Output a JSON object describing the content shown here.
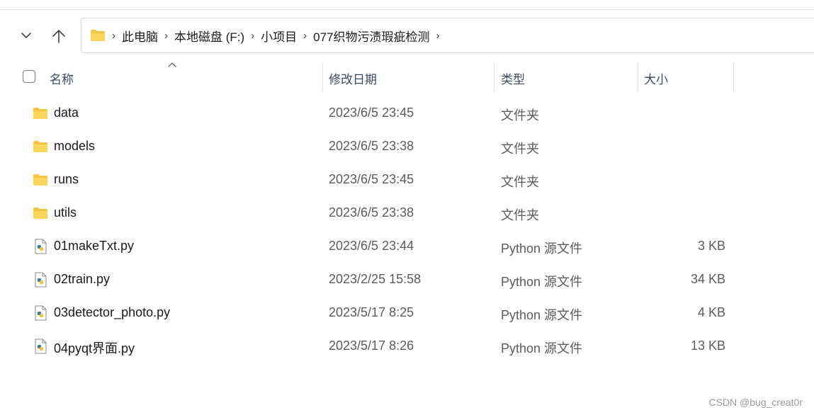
{
  "navigation": {
    "recent_icon": "chevron-down",
    "up_icon": "arrow-up"
  },
  "address": {
    "folder_icon": "folder",
    "crumbs": [
      "此电脑",
      "本地磁盘 (F:)",
      "小项目",
      "077织物污渍瑕疵检测"
    ],
    "separator": "›"
  },
  "columns": {
    "name": "名称",
    "date": "修改日期",
    "type": "类型",
    "size": "大小"
  },
  "files": [
    {
      "name": "data",
      "date": "2023/6/5 23:45",
      "type": "文件夹",
      "size": "",
      "icon": "folder"
    },
    {
      "name": "models",
      "date": "2023/6/5 23:38",
      "type": "文件夹",
      "size": "",
      "icon": "folder"
    },
    {
      "name": "runs",
      "date": "2023/6/5 23:45",
      "type": "文件夹",
      "size": "",
      "icon": "folder"
    },
    {
      "name": "utils",
      "date": "2023/6/5 23:38",
      "type": "文件夹",
      "size": "",
      "icon": "folder"
    },
    {
      "name": "01makeTxt.py",
      "date": "2023/6/5 23:44",
      "type": "Python 源文件",
      "size": "3 KB",
      "icon": "python-file"
    },
    {
      "name": "02train.py",
      "date": "2023/2/25 15:58",
      "type": "Python 源文件",
      "size": "34 KB",
      "icon": "python-file"
    },
    {
      "name": "03detector_photo.py",
      "date": "2023/5/17 8:25",
      "type": "Python 源文件",
      "size": "4 KB",
      "icon": "python-file"
    },
    {
      "name": "04pyqt界面.py",
      "date": "2023/5/17 8:26",
      "type": "Python 源文件",
      "size": "13 KB",
      "icon": "python-file"
    }
  ],
  "colors": {
    "folder": "#f4c542",
    "header_text": "#3a4b63",
    "secondary_text": "#5c5c5c"
  },
  "watermark": "CSDN @bug_creat0r"
}
